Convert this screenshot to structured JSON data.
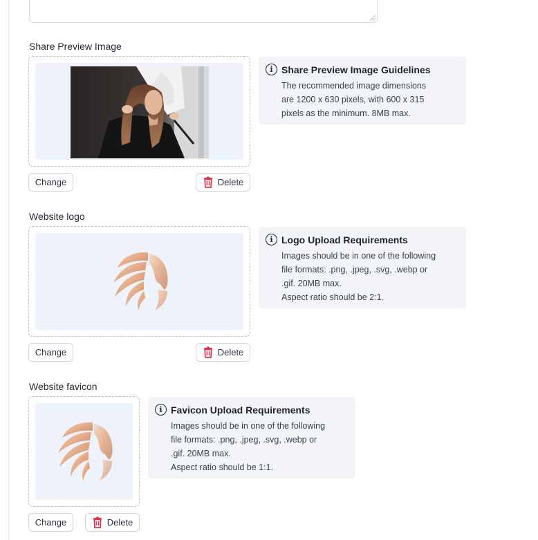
{
  "sections": [
    {
      "label": "Share Preview Image",
      "info_title": "Share Preview Image Guidelines",
      "info_lines": [
        "The recommended image dimensions",
        "are 1200 x 630 pixels, with 600 x 315",
        "pixels as the minimum. 8MB max."
      ],
      "change_label": "Change",
      "delete_label": "Delete"
    },
    {
      "label": "Website logo",
      "info_title": "Logo Upload Requirements",
      "info_lines": [
        "Images should be in one of the following",
        "file formats: .png, .jpeg, .svg, .webp or",
        ".gif. 20MB max.",
        "Aspect ratio should be 2:1."
      ],
      "change_label": "Change",
      "delete_label": "Delete"
    },
    {
      "label": "Website favicon",
      "info_title": "Favicon Upload Requirements",
      "info_lines": [
        "Images should be in one of the following",
        "file formats: .png, .jpeg, .svg, .webp or",
        ".gif. 20MB max.",
        "Aspect ratio should be 1:1."
      ],
      "change_label": "Change",
      "delete_label": "Delete"
    }
  ],
  "icons": {
    "info": "info-circle-icon",
    "delete": "trash-icon",
    "resize": "resize-grip-icon"
  },
  "colors": {
    "delete_icon": "#e0324b",
    "preview_bg": "#eef2fa",
    "info_bg": "#f2f4f8"
  }
}
